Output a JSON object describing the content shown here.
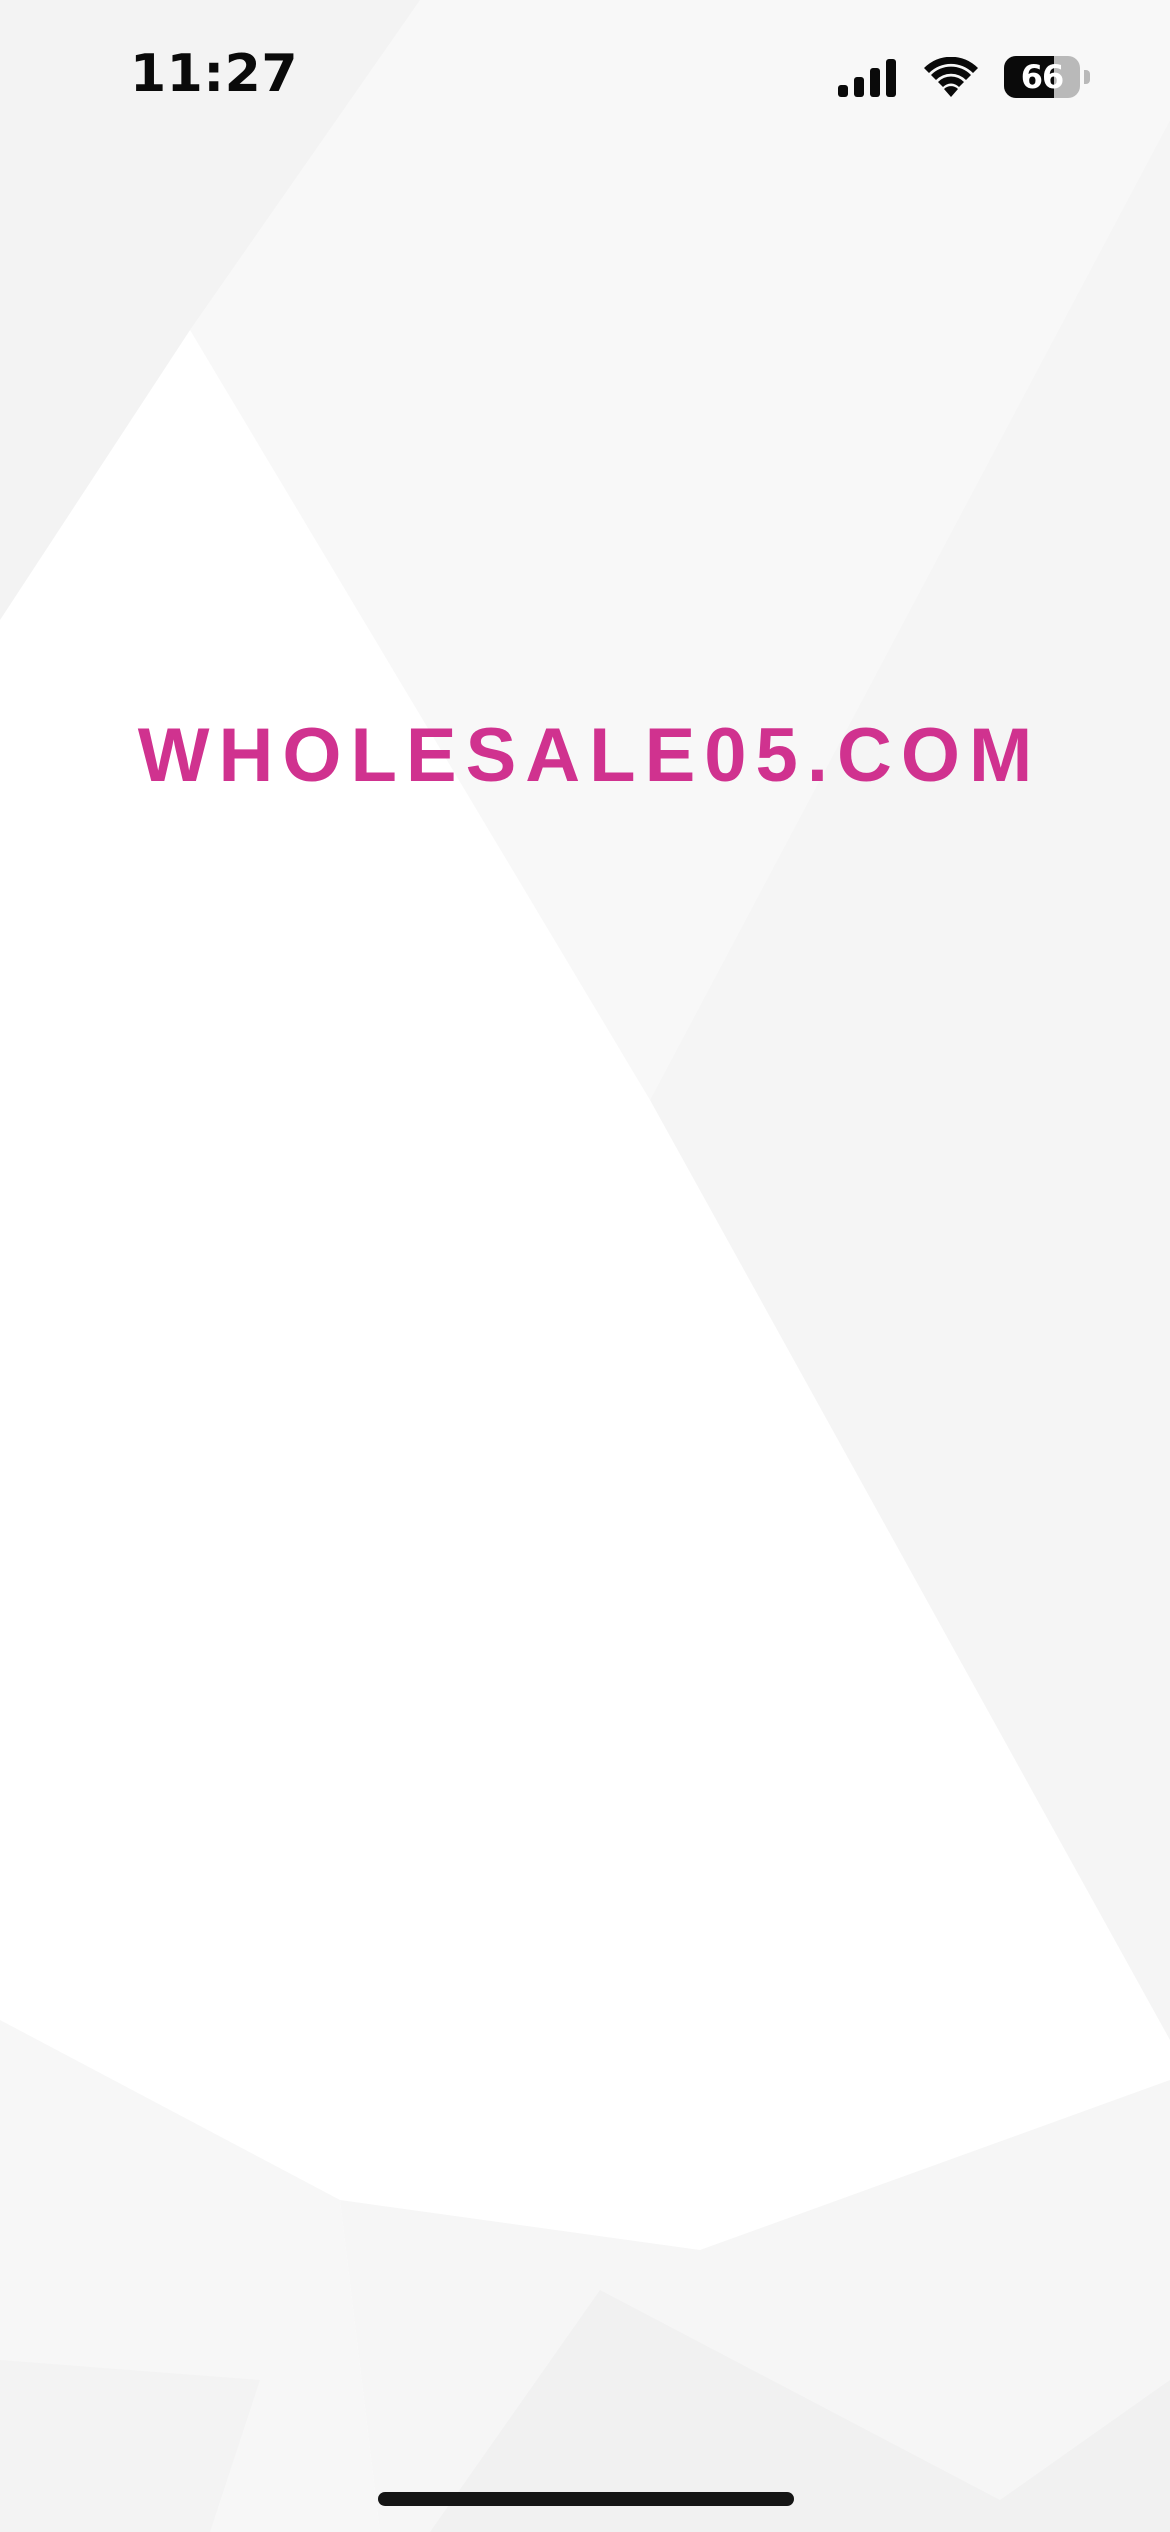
{
  "status_bar": {
    "time": "11:27",
    "battery_percent": 66,
    "battery_label": "66",
    "icons": [
      "signal-icon",
      "wifi-icon",
      "battery-icon"
    ]
  },
  "brand": {
    "logo_text": "WHOLESALE05.COM",
    "color": "#d0328f"
  },
  "colors": {
    "background": "#ffffff",
    "facet_light": "#f7f7f7",
    "facet_mid": "#f1f1f1",
    "home_indicator": "#151515"
  }
}
